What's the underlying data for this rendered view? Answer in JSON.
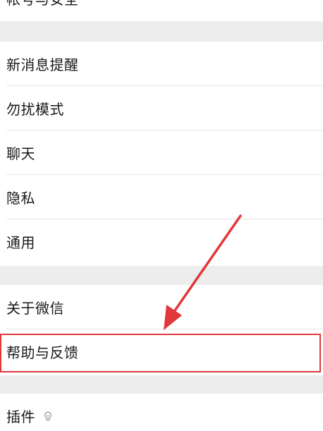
{
  "settings": {
    "account_security": "帐号与安全",
    "new_message_alert": "新消息提醒",
    "do_not_disturb": "勿扰模式",
    "chat": "聊天",
    "privacy": "隐私",
    "general": "通用",
    "about": "关于微信",
    "help_feedback": "帮助与反馈",
    "plugins": "插件"
  },
  "annotation": {
    "highlight_color": "#e0383b"
  },
  "icons": {
    "plugin": "plugin-bulb-icon"
  }
}
